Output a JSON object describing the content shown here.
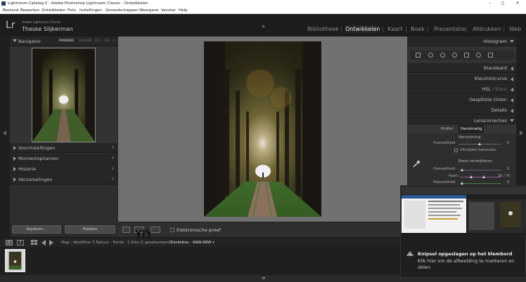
{
  "window": {
    "title": "Lightroom Catalog-2 - Adobe Photoshop Lightroom Classic - Ontwikkelen",
    "controls": {
      "minimize": "–",
      "maximize": "◻",
      "close": "✕"
    }
  },
  "menubar": [
    "Bestand",
    "Bewerken",
    "Ontwikkelen",
    "Foto",
    "Instellingen",
    "Gereedschappen",
    "Weergave",
    "Venster",
    "Help"
  ],
  "identity": {
    "logo": "Lr",
    "product": "Adobe Lightroom Classic",
    "user": "Theske Slijkerman"
  },
  "modules": {
    "items": [
      "Bibliotheek",
      "Ontwikkelen",
      "Kaart",
      "Boek",
      "Presentatie",
      "Afdrukken",
      "Web"
    ],
    "active": "Ontwikkelen",
    "separator": "|"
  },
  "left_panel": {
    "navigator": {
      "label": "Navigator",
      "zoom_options": [
        "PASSEND",
        "VULLEN",
        "1:1",
        "1:8"
      ],
      "active_zoom": "PASSEND",
      "more": "÷"
    },
    "sections": [
      {
        "label": "Voorinstellingen",
        "control": "+"
      },
      {
        "label": "Momentopnamen",
        "control": "+"
      },
      {
        "label": "Historie",
        "control": "×"
      },
      {
        "label": "Verzamelingen",
        "control": "+"
      }
    ],
    "buttons": {
      "copy": "Kopiëren...",
      "paste": "Plakken"
    }
  },
  "toolbar": {
    "soft_proof_label": "Elektronische proef",
    "compare_label": "Y|Y"
  },
  "right_panel": {
    "histogram": "Histogram",
    "panels": [
      {
        "label": "Standaard"
      },
      {
        "label": "Kleurtintcurve"
      },
      {
        "label": "HSL",
        "secondary": "Kleur"
      },
      {
        "label": "Gesplitste tinten"
      },
      {
        "label": "Details"
      },
      {
        "label": "Lenscorrecties"
      }
    ],
    "lens_tabs": [
      "Profiel",
      "Handmatig"
    ],
    "lens_active_tab": "Handmatig",
    "distortion": {
      "title": "Vervorming",
      "amount_label": "Hoeveelheid",
      "amount_value": "0",
      "constrain_label": "Uitsnijden behouden"
    },
    "defringe": {
      "title": "Rand verwijderen",
      "purple_amount_label": "Hoeveelheid",
      "purple_amount_value": "0",
      "purple_hue_label": "Paars",
      "purple_hue_value": "30 / 70",
      "green_amount_label": "Hoeveelheid",
      "green_amount_value": "0"
    }
  },
  "filmstrip": {
    "pages": [
      "1",
      "2"
    ],
    "path": "Map : Workflow 3 Natuur - Eerde",
    "count": "1 foto /1 geselecteerd",
    "filename_prefix": "/",
    "filename": "Eerdebos - RAW.ARW"
  },
  "toast": {
    "title": "Knipsel opgeslagen op het klembord",
    "body": "Klik hier om de afbeelding te markeren en delen"
  },
  "colors": {
    "panel_bg": "#2e2e2e",
    "center_bg": "#717171",
    "identity_bg": "#1c1c1c",
    "module_active": "#ededed"
  }
}
